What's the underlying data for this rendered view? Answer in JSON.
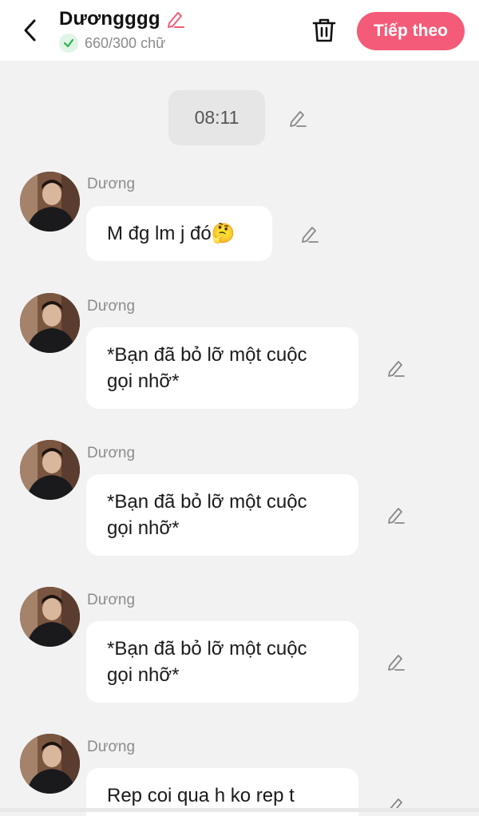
{
  "header": {
    "title": "Dươngggg",
    "char_count": "660/300 chữ",
    "next_label": "Tiếp theo",
    "accent": "#f45b78",
    "icons": [
      "back-arrow-icon",
      "pencil-icon",
      "check-icon",
      "trash-icon"
    ]
  },
  "timestamp": "08:11",
  "messages": [
    {
      "sender": "Dương",
      "text": "M đg lm j đó🤔"
    },
    {
      "sender": "Dương",
      "text": "*Bạn đã bỏ lỡ một cuộc gọi nhỡ*"
    },
    {
      "sender": "Dương",
      "text": "*Bạn đã bỏ lỡ một cuộc gọi nhỡ*"
    },
    {
      "sender": "Dương",
      "text": "*Bạn đã bỏ lỡ một cuộc gọi nhỡ*"
    },
    {
      "sender": "Dương",
      "text": "Rep coi qua h ko rep t"
    }
  ]
}
